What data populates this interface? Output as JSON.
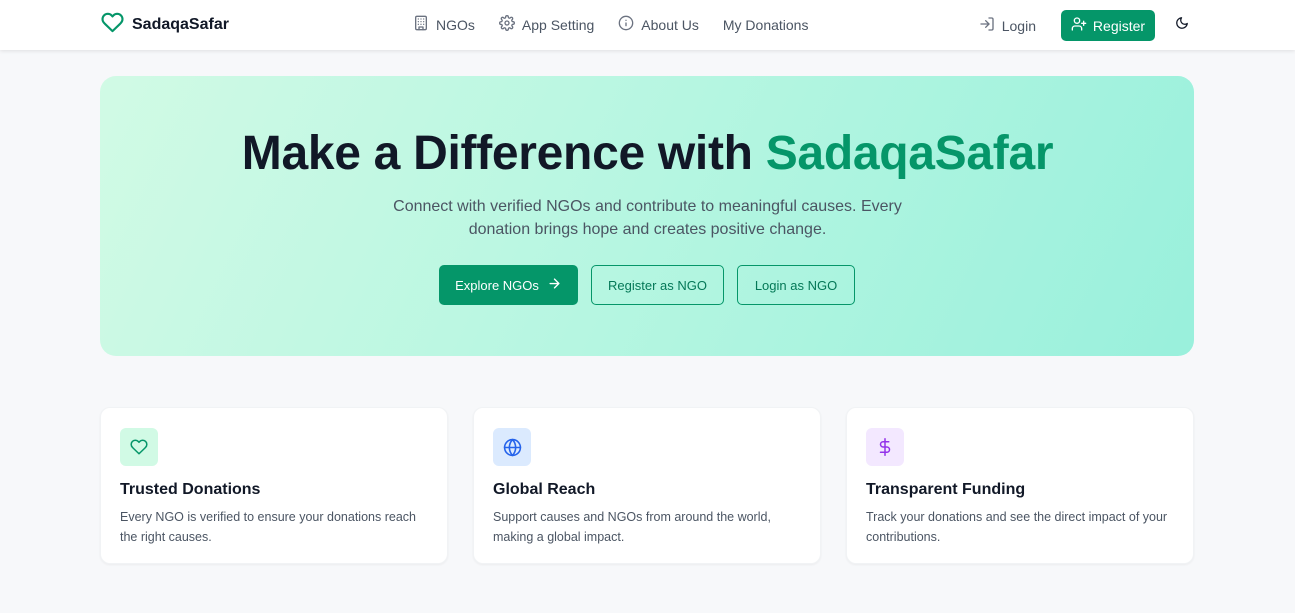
{
  "brand": {
    "name": "SadaqaSafar",
    "accent_color": "#059669"
  },
  "nav": {
    "links": [
      {
        "label": "NGOs",
        "icon": "building-icon"
      },
      {
        "label": "App Setting",
        "icon": "gear-icon"
      },
      {
        "label": "About Us",
        "icon": "info-icon"
      },
      {
        "label": "My Donations",
        "icon": ""
      }
    ],
    "login_label": "Login",
    "register_label": "Register",
    "theme_icon": "moon-icon"
  },
  "hero": {
    "title_main": "Make a Difference with ",
    "title_accent": "SadaqaSafar",
    "subtitle": "Connect with verified NGOs and contribute to meaningful causes. Every donation brings hope and creates positive change.",
    "primary_button": "Explore NGOs",
    "register_ngo_button": "Register as NGO",
    "login_ngo_button": "Login as NGO"
  },
  "features": [
    {
      "title": "Trusted Donations",
      "description": "Every NGO is verified to ensure your donations reach the right causes.",
      "icon": "heart-icon",
      "icon_bg": "#d1fae5",
      "icon_color": "#059669"
    },
    {
      "title": "Global Reach",
      "description": "Support causes and NGOs from around the world, making a global impact.",
      "icon": "globe-icon",
      "icon_bg": "#dbeafe",
      "icon_color": "#2563eb"
    },
    {
      "title": "Transparent Funding",
      "description": "Track your donations and see the direct impact of your contributions.",
      "icon": "dollar-icon",
      "icon_bg": "#f3e8ff",
      "icon_color": "#9333ea"
    }
  ]
}
